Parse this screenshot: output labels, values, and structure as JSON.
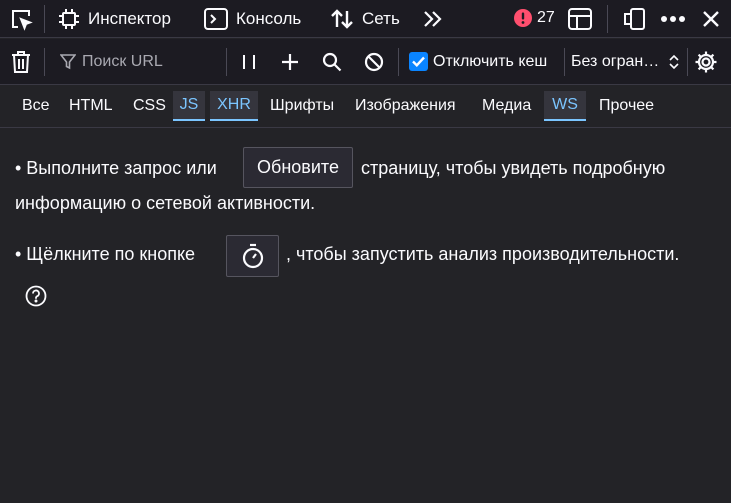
{
  "tabs": [
    {
      "label": "Инспектор",
      "icon": "inspector-icon"
    },
    {
      "label": "Консоль",
      "icon": "console-icon"
    },
    {
      "label": "Сеть",
      "icon": "network-icon"
    }
  ],
  "header": {
    "error_count": "27",
    "error_color": "#ff4f6e",
    "accent": "#0a84ff"
  },
  "toolbar": {
    "search_placeholder": "Поиск URL",
    "disable_cache_label": "Отключить кеш",
    "disable_cache_checked": true,
    "throttle_value": "Без огран…"
  },
  "filters": [
    {
      "label": "Все",
      "active": false
    },
    {
      "label": "HTML",
      "active": false
    },
    {
      "label": "CSS",
      "active": false
    },
    {
      "label": "JS",
      "active": true
    },
    {
      "label": "XHR",
      "active": true
    },
    {
      "label": "Шрифты",
      "active": false
    },
    {
      "label": "Изображения",
      "active": false
    },
    {
      "label": "Медиа",
      "active": false
    },
    {
      "label": "WS",
      "active": true
    },
    {
      "label": "Прочее",
      "active": false
    }
  ],
  "empty": {
    "line1_before": "• Выполните запрос или",
    "reload_button": "Обновите",
    "line1_after": "страницу, чтобы увидеть подробную",
    "line2": "информацию о сетевой активности.",
    "line3_before": "• Щёлкните по кнопке",
    "line3_after": ", чтобы запустить анализ производительности."
  }
}
